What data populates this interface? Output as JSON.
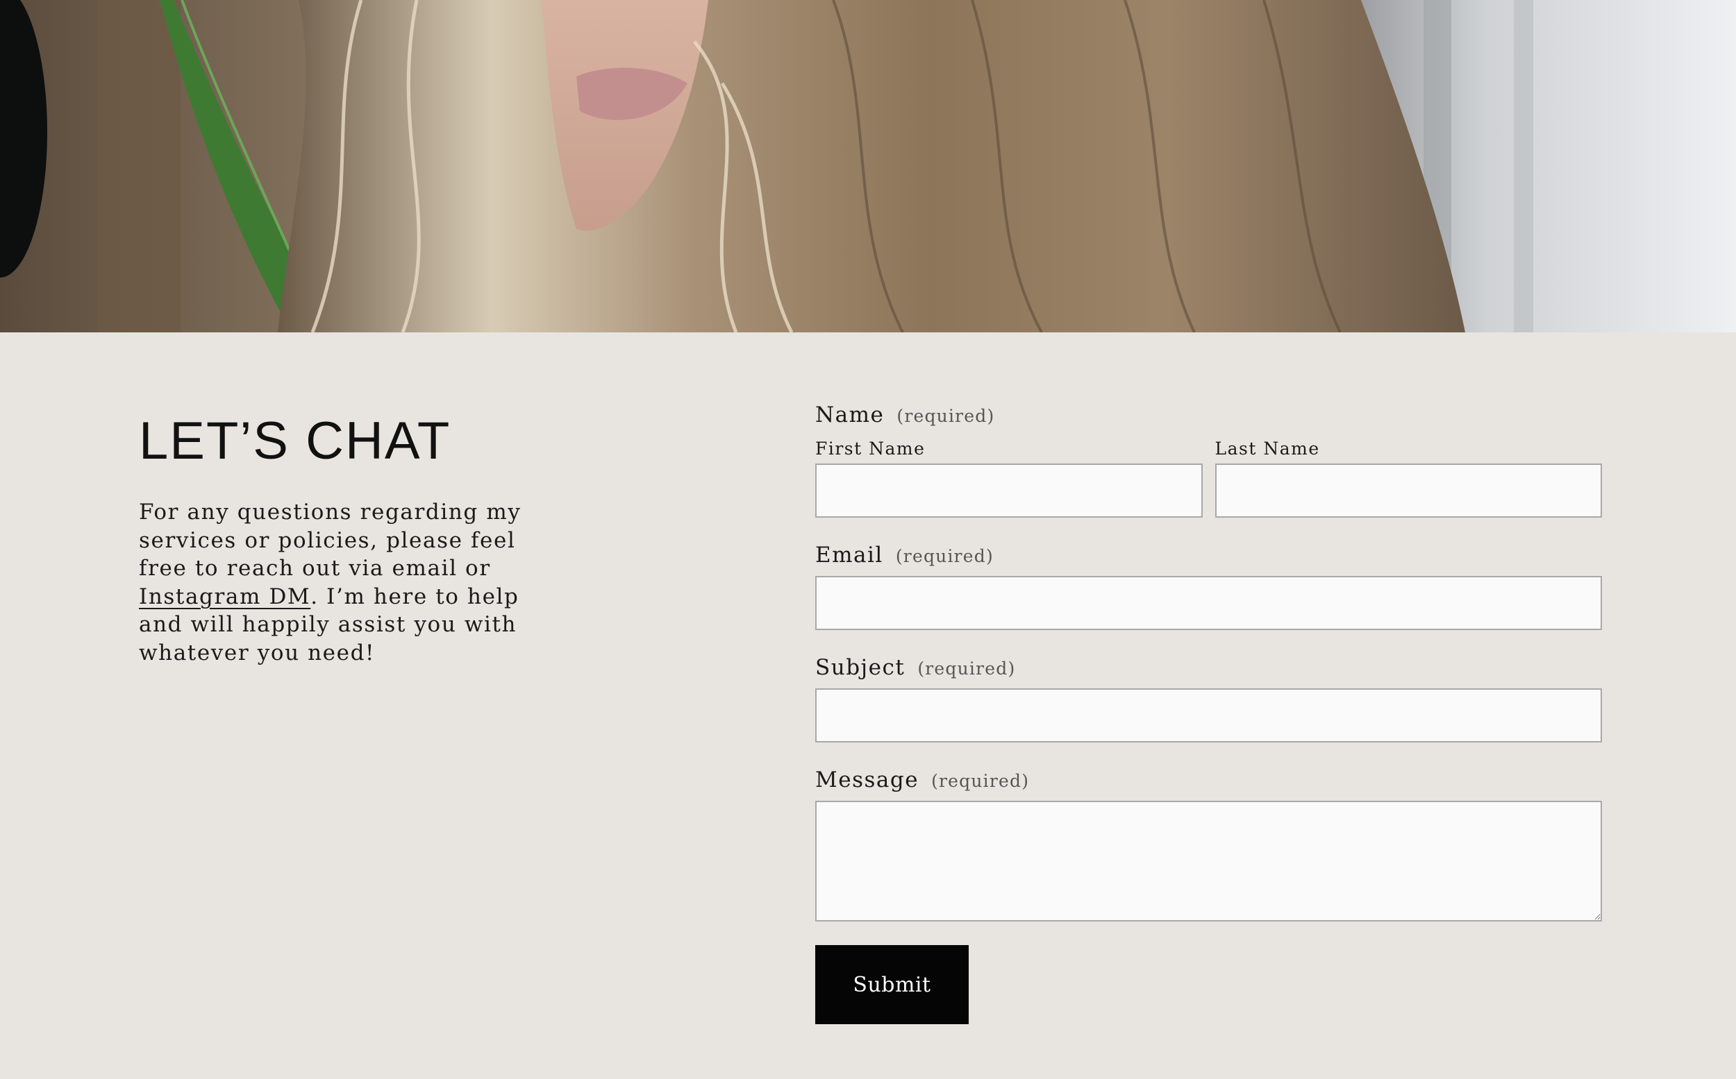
{
  "intro": {
    "heading": "LET’S CHAT",
    "text_before_link": "For any questions regarding my services or policies, please feel free to reach out via email or ",
    "link_text": "Instagram DM",
    "text_after_link": ". I’m here to help and will happily assist you with whatever you need!"
  },
  "form": {
    "name": {
      "label": "Name",
      "required": "(required)",
      "first_label": "First Name",
      "first_value": "",
      "last_label": "Last Name",
      "last_value": ""
    },
    "email": {
      "label": "Email",
      "required": "(required)",
      "value": ""
    },
    "subject": {
      "label": "Subject",
      "required": "(required)",
      "value": ""
    },
    "message": {
      "label": "Message",
      "required": "(required)",
      "value": ""
    },
    "submit_label": "Submit"
  }
}
